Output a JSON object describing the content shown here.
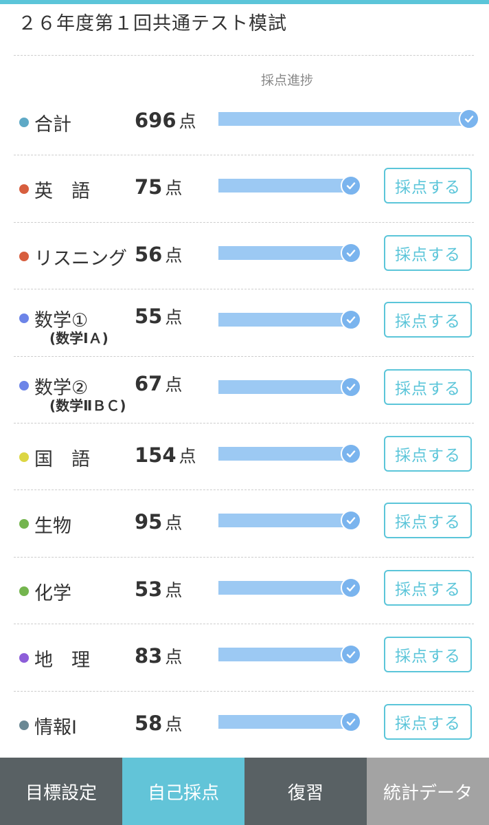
{
  "header": {
    "title": "２６年度第１回共通テスト模試"
  },
  "progress_header": "採点進捗",
  "score_unit": "点",
  "grade_button_label": "採点する",
  "colors": {
    "accent": "#5bc5d9",
    "bar": "#9cc9f3",
    "check": "#7ab4ee",
    "nav_bg": "#596164",
    "nav_active": "#62c4d8",
    "nav_disabled": "#a3a3a3"
  },
  "subjects": [
    {
      "name": "合計",
      "sub": "",
      "score": "696",
      "progress": 1.0,
      "dot": "#5ea9c6",
      "has_button": false
    },
    {
      "name": "英　語",
      "sub": "",
      "score": "75",
      "progress": 1.0,
      "dot": "#d75e3e",
      "has_button": true
    },
    {
      "name": "リスニング",
      "sub": "",
      "score": "56",
      "progress": 1.0,
      "dot": "#d75e3e",
      "has_button": true
    },
    {
      "name": "数学①",
      "sub": "(数学ⅠＡ)",
      "score": "55",
      "progress": 1.0,
      "dot": "#6c84e8",
      "has_button": true
    },
    {
      "name": "数学②",
      "sub": "(数学ⅡＢＣ)",
      "score": "67",
      "progress": 1.0,
      "dot": "#6c84e8",
      "has_button": true
    },
    {
      "name": "国　語",
      "sub": "",
      "score": "154",
      "progress": 1.0,
      "dot": "#dcd643",
      "has_button": true
    },
    {
      "name": "生物",
      "sub": "",
      "score": "95",
      "progress": 1.0,
      "dot": "#74b54e",
      "has_button": true
    },
    {
      "name": "化学",
      "sub": "",
      "score": "53",
      "progress": 1.0,
      "dot": "#74b54e",
      "has_button": true
    },
    {
      "name": "地　理",
      "sub": "",
      "score": "83",
      "progress": 1.0,
      "dot": "#8d5ed9",
      "has_button": true
    },
    {
      "name": "情報Ⅰ",
      "sub": "",
      "score": "58",
      "progress": 1.0,
      "dot": "#6a8894",
      "has_button": true
    }
  ],
  "nav": [
    {
      "label": "目標設定",
      "state": "normal"
    },
    {
      "label": "自己採点",
      "state": "active"
    },
    {
      "label": "復習",
      "state": "normal"
    },
    {
      "label": "統計データ",
      "state": "disabled"
    }
  ]
}
